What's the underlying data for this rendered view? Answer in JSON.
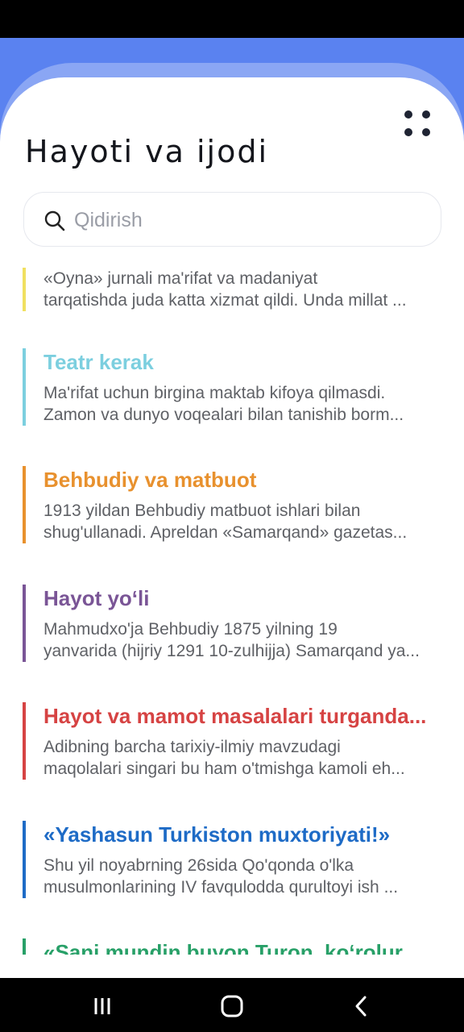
{
  "header": {
    "title": "Hayoti va ijodi"
  },
  "search": {
    "placeholder": "Qidirish"
  },
  "items": [
    {
      "title": "",
      "color": "#f0e060",
      "line1": "«Oyna» jurnali ma'rifat va madaniyat",
      "line2": "tarqatishda juda katta xizmat qildi. Unda millat ..."
    },
    {
      "title": "Teatr kerak",
      "color": "#7ccfdf",
      "line1": "Ma'rifat uchun birgina maktab kifoya qilmasdi.",
      "line2": "Zamon va dunyo voqealari bilan tanishib borm..."
    },
    {
      "title": "Behbudiy va matbuot",
      "color": "#e8912e",
      "line1": "1913 yildan Behbudiy matbuot ishlari bilan",
      "line2": "shug'ullanadi. Apreldan «Samarqand» gazetas..."
    },
    {
      "title": "Hayot yo‘li",
      "color": "#7a5596",
      "line1": "Mahmudxo'ja Behbudiy 1875 yilning 19",
      "line2": "yanvarida (hijriy 1291 10-zulhijja) Samarqand ya..."
    },
    {
      "title": "Hayot va mamot masalalari turganda...",
      "color": "#d64343",
      "line1": "Adibning barcha tarixiy-ilmiy mavzudagi",
      "line2": "maqolalari singari bu ham o'tmishga kamoli eh..."
    },
    {
      "title": "«Yashasun Turkiston muxtoriyati!»",
      "color": "#1e6bc6",
      "line1": "Shu yil noyabrning 26sida Qo'qonda o'lka",
      "line2": "musulmonlarining IV favqulodda qurultoyi ish ..."
    },
    {
      "title": "«Sani mundin buyon Turon, ko‘rolurmu",
      "color": "#28a068",
      "line1": "",
      "line2": ""
    }
  ],
  "icons": {
    "menu": "dots-grid-icon",
    "search": "search-icon",
    "nav_recent": "recent-apps-icon",
    "nav_home": "home-icon",
    "nav_back": "back-icon"
  }
}
